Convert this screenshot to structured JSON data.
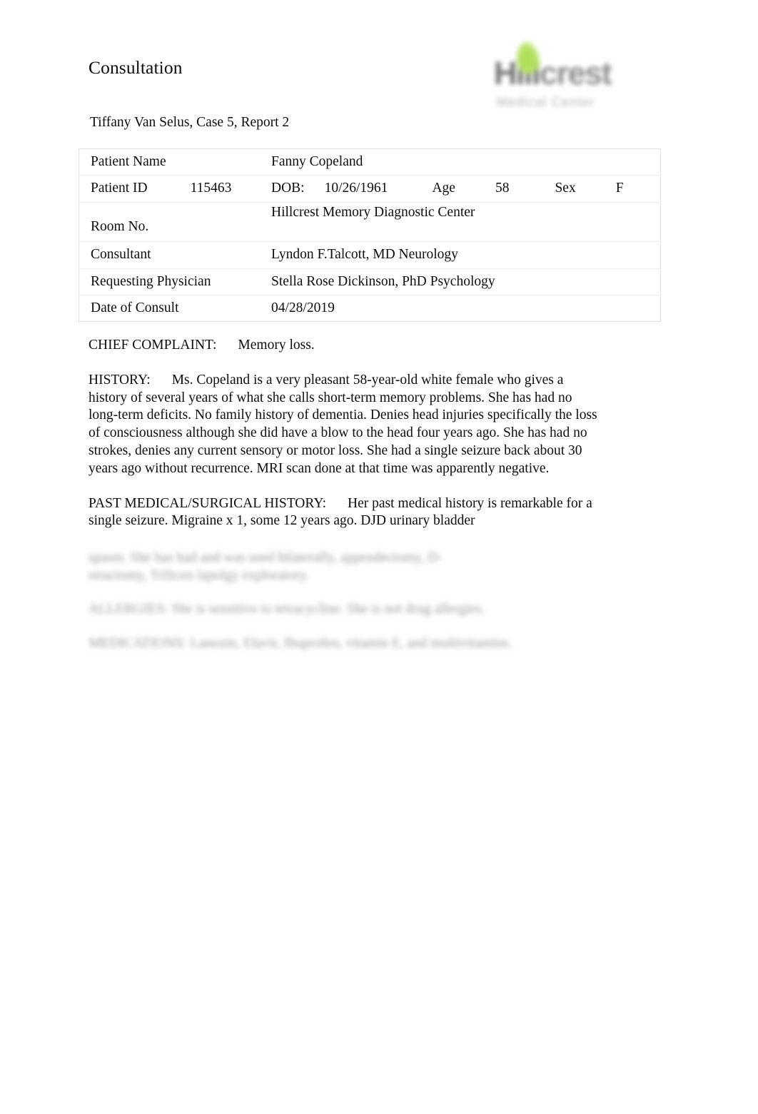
{
  "document": {
    "title": "Consultation",
    "subtitle": "Tiffany Van Selus, Case 5, Report 2"
  },
  "logo": {
    "wordmark_light": "Hill",
    "wordmark_dark": "crest",
    "tagline": "Medical Center",
    "leaf_color": "#a9dd4e",
    "wordmark_color": "#8d8d8d"
  },
  "info_table": {
    "rows": [
      {
        "label": "Patient Name",
        "value": "Fanny Copeland"
      },
      {
        "label": "Patient ID",
        "label_value": "115463",
        "dob_label": "DOB:",
        "dob_value": "10/26/1961",
        "age_label": "Age",
        "age_value": "58",
        "sex_label": "Sex",
        "sex_value": "F"
      },
      {
        "label": "Room No.",
        "value": "Hillcrest Memory Diagnostic Center"
      },
      {
        "label": "Consultant",
        "value": "Lyndon F.Talcott, MD Neurology"
      },
      {
        "label": "Requesting Physician",
        "value": "Stella Rose Dickinson, PhD Psychology"
      },
      {
        "label": "Date of Consult",
        "value": "04/28/2019"
      }
    ]
  },
  "body": {
    "chief_complaint": {
      "label": "CHIEF COMPLAINT:",
      "text": "Memory loss."
    },
    "history": {
      "label": "HISTORY:",
      "text": "Ms. Copeland is a very pleasant 58-year-old white female who gives a history of several years of what she calls short-term memory problems. She has had no long-term deficits. No family history of dementia. Denies head injuries specifically the loss of consciousness although she did have a blow to the head four years ago. She has had no strokes, denies any current sensory or motor loss. She had a single seizure back about 30 years ago without recurrence. MRI scan done at that time was apparently negative."
    },
    "past_medical_surgical_history": {
      "label": "PAST MEDICAL/SURGICAL HISTORY:",
      "text": "Her past medical history is remarkable for a single seizure. Migraine x 1, some 12 years ago. DJD urinary bladder"
    },
    "redacted_continuation": "spasm. She has had and was used bilaterally, appendectomy, D-structomy, Trilicen lapolgy exploratory.",
    "redacted_section_2": "ALLERGIES:   She is sensitive to tetracycline. She is not drug allergies.",
    "redacted_section_3": "MEDICATIONS:   Lanoxin, Elavir, Ibuprofen, vitamin E, and multivitamins."
  }
}
